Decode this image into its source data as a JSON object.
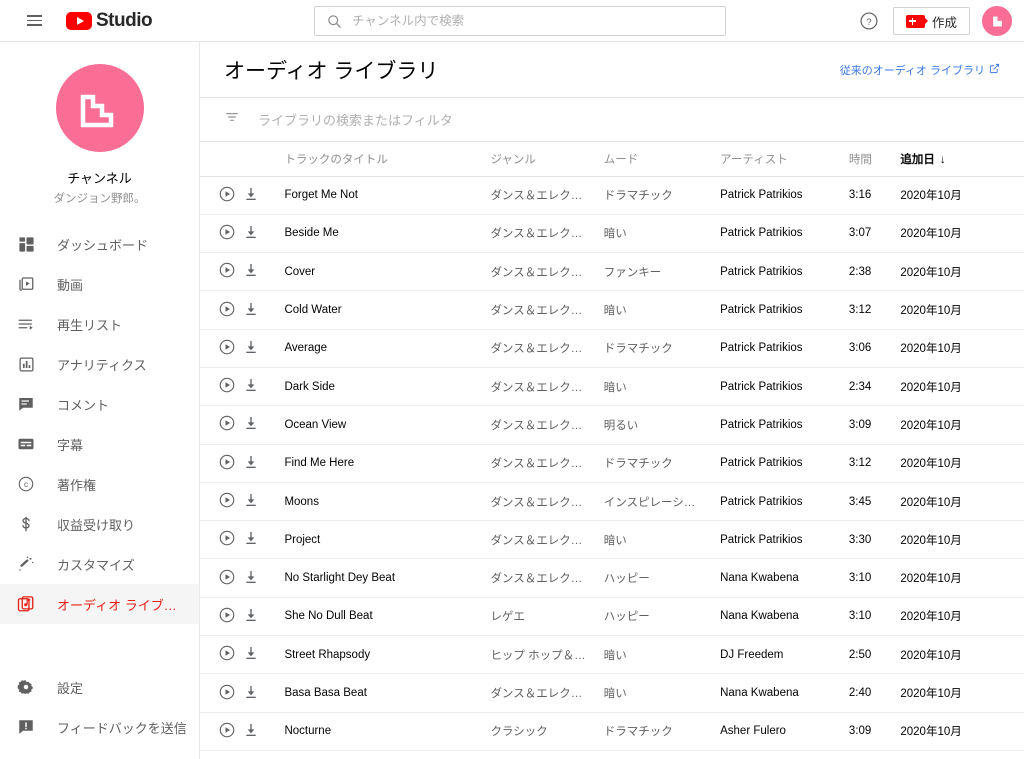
{
  "topbar": {
    "menu_icon": "hamburger-icon",
    "logo_text": "Studio",
    "search": {
      "placeholder": "チャンネル内で検索",
      "value": "",
      "icon": "search-icon"
    },
    "help_icon": "help-circle-icon",
    "create_label": "作成",
    "create_icon": "video-camera-plus-icon",
    "avatar_icon": "channel-avatar"
  },
  "sidebar": {
    "channel_label": "チャンネル",
    "channel_name": "ダンジョン野郎。",
    "avatar_color": "#fa6e96",
    "items": [
      {
        "label": "ダッシュボード",
        "icon": "dashboard-icon",
        "active": false
      },
      {
        "label": "動画",
        "icon": "video-icon",
        "active": false
      },
      {
        "label": "再生リスト",
        "icon": "playlist-icon",
        "active": false
      },
      {
        "label": "アナリティクス",
        "icon": "analytics-icon",
        "active": false
      },
      {
        "label": "コメント",
        "icon": "comment-icon",
        "active": false
      },
      {
        "label": "字幕",
        "icon": "subtitles-icon",
        "active": false
      },
      {
        "label": "著作権",
        "icon": "copyright-icon",
        "active": false
      },
      {
        "label": "収益受け取り",
        "icon": "dollar-icon",
        "active": false
      },
      {
        "label": "カスタマイズ",
        "icon": "customize-wand-icon",
        "active": false
      },
      {
        "label": "オーディオ ライブ…",
        "icon": "audio-library-icon",
        "active": true
      }
    ],
    "bottom_items": [
      {
        "label": "設定",
        "icon": "gear-icon"
      },
      {
        "label": "フィードバックを送信",
        "icon": "feedback-icon"
      }
    ],
    "active_color": "#e62117"
  },
  "main": {
    "page_title": "オーディオ ライブラリ",
    "legacy_link": "従来のオーディオ ライブラリ",
    "legacy_link_icon": "external-link-icon",
    "legacy_link_color": "#3b78e7",
    "filter": {
      "placeholder": "ライブラリの検索またはフィルタ",
      "value": "",
      "icon": "filter-icon"
    },
    "columns": {
      "play": "",
      "download": "",
      "title": "トラックのタイトル",
      "genre": "ジャンル",
      "mood": "ムード",
      "artist": "アーティスト",
      "duration": "時間",
      "date_added": "追加日",
      "sort_indicator": "↓",
      "sorted_column": "date_added"
    },
    "tracks": [
      {
        "title": "Forget Me Not",
        "genre": "ダンス＆エレク…",
        "mood": "ドラマチック",
        "artist": "Patrick Patrikios",
        "duration": "3:16",
        "date": "2020年10月"
      },
      {
        "title": "Beside Me",
        "genre": "ダンス＆エレク…",
        "mood": "暗い",
        "artist": "Patrick Patrikios",
        "duration": "3:07",
        "date": "2020年10月"
      },
      {
        "title": "Cover",
        "genre": "ダンス＆エレク…",
        "mood": "ファンキー",
        "artist": "Patrick Patrikios",
        "duration": "2:38",
        "date": "2020年10月"
      },
      {
        "title": "Cold Water",
        "genre": "ダンス＆エレク…",
        "mood": "暗い",
        "artist": "Patrick Patrikios",
        "duration": "3:12",
        "date": "2020年10月"
      },
      {
        "title": "Average",
        "genre": "ダンス＆エレク…",
        "mood": "ドラマチック",
        "artist": "Patrick Patrikios",
        "duration": "3:06",
        "date": "2020年10月"
      },
      {
        "title": "Dark Side",
        "genre": "ダンス＆エレク…",
        "mood": "暗い",
        "artist": "Patrick Patrikios",
        "duration": "2:34",
        "date": "2020年10月"
      },
      {
        "title": "Ocean View",
        "genre": "ダンス＆エレク…",
        "mood": "明るい",
        "artist": "Patrick Patrikios",
        "duration": "3:09",
        "date": "2020年10月"
      },
      {
        "title": "Find Me Here",
        "genre": "ダンス＆エレク…",
        "mood": "ドラマチック",
        "artist": "Patrick Patrikios",
        "duration": "3:12",
        "date": "2020年10月"
      },
      {
        "title": "Moons",
        "genre": "ダンス＆エレク…",
        "mood": "インスピレーシ…",
        "artist": "Patrick Patrikios",
        "duration": "3:45",
        "date": "2020年10月"
      },
      {
        "title": "Project",
        "genre": "ダンス＆エレク…",
        "mood": "暗い",
        "artist": "Patrick Patrikios",
        "duration": "3:30",
        "date": "2020年10月"
      },
      {
        "title": "No Starlight Dey Beat",
        "genre": "ダンス＆エレク…",
        "mood": "ハッピー",
        "artist": "Nana Kwabena",
        "duration": "3:10",
        "date": "2020年10月"
      },
      {
        "title": "She No Dull Beat",
        "genre": "レゲエ",
        "mood": "ハッピー",
        "artist": "Nana Kwabena",
        "duration": "3:10",
        "date": "2020年10月"
      },
      {
        "title": "Street Rhapsody",
        "genre": "ヒップ ホップ＆…",
        "mood": "暗い",
        "artist": "DJ Freedem",
        "duration": "2:50",
        "date": "2020年10月"
      },
      {
        "title": "Basa Basa Beat",
        "genre": "ダンス＆エレク…",
        "mood": "暗い",
        "artist": "Nana Kwabena",
        "duration": "2:40",
        "date": "2020年10月"
      },
      {
        "title": "Nocturne",
        "genre": "クラシック",
        "mood": "ドラマチック",
        "artist": "Asher Fulero",
        "duration": "3:09",
        "date": "2020年10月"
      }
    ],
    "row_icons": {
      "play": "play-circle-icon",
      "download": "download-icon"
    }
  }
}
